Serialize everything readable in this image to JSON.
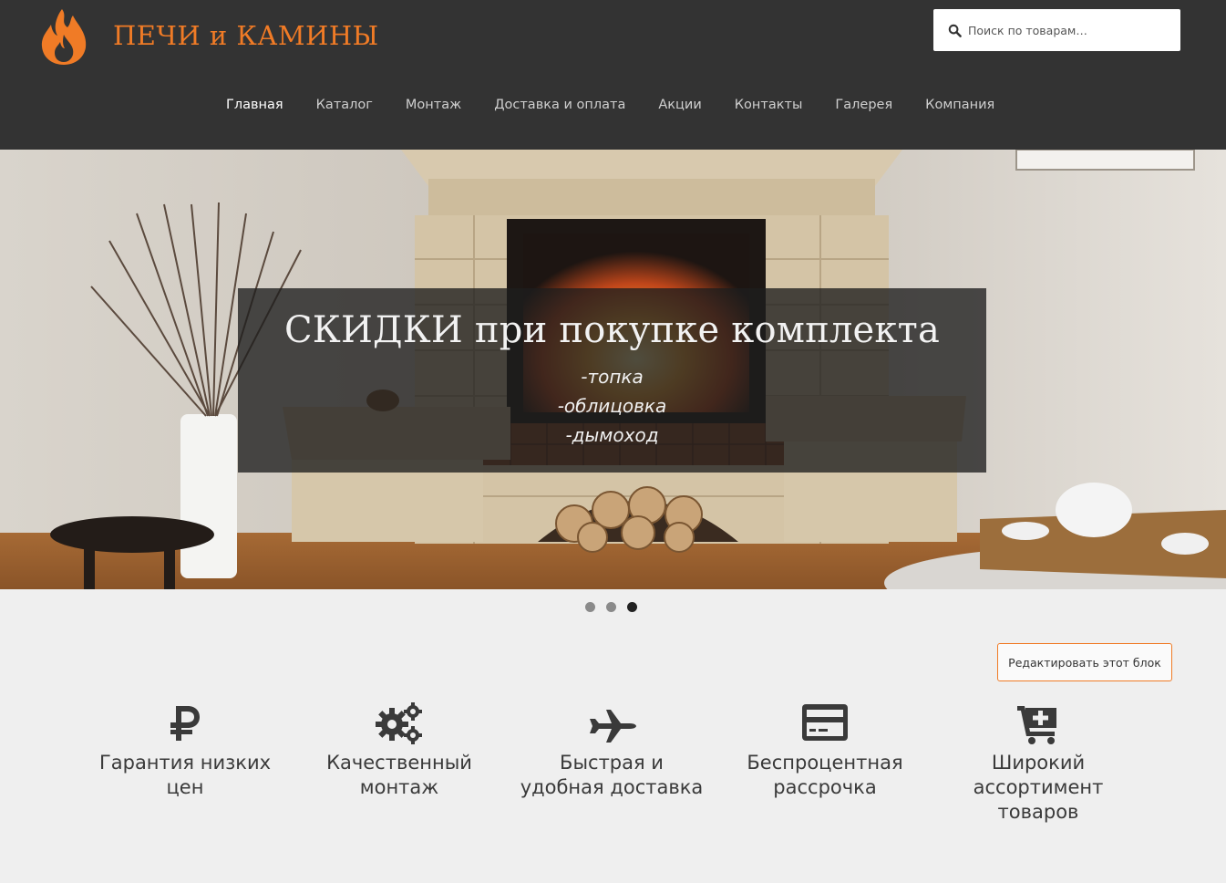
{
  "site": {
    "title": "ПЕЧИ и КАМИНЫ",
    "logo_icon": "flame-icon"
  },
  "search": {
    "placeholder": "Поиск по товарам…",
    "icon": "search-icon"
  },
  "nav": {
    "items": [
      {
        "label": "Главная",
        "active": true
      },
      {
        "label": "Каталог"
      },
      {
        "label": "Монтаж"
      },
      {
        "label": "Доставка и оплата"
      },
      {
        "label": "Акции"
      },
      {
        "label": "Контакты"
      },
      {
        "label": "Галерея"
      },
      {
        "label": "Компания"
      }
    ]
  },
  "slider": {
    "caption_title": "СКИДКИ при покупке комплекта",
    "caption_lines": [
      "-топка",
      "-облицовка",
      "-дымоход"
    ],
    "slide_count": 3,
    "active_slide": 3
  },
  "edit_block": {
    "label": "Редактировать этот блок"
  },
  "features": [
    {
      "icon": "ruble-icon",
      "label": "Гарантия низких цен"
    },
    {
      "icon": "gears-icon",
      "label": "Качественный монтаж"
    },
    {
      "icon": "plane-icon",
      "label": "Быстрая и удобная доставка"
    },
    {
      "icon": "credit-card-icon",
      "label": "Беспроцентная рассрочка"
    },
    {
      "icon": "cart-plus-icon",
      "label": "Широкий ассортимент товаров"
    }
  ],
  "colors": {
    "accent": "#f07b26",
    "header_bg": "#333333",
    "page_bg": "#efefef"
  }
}
